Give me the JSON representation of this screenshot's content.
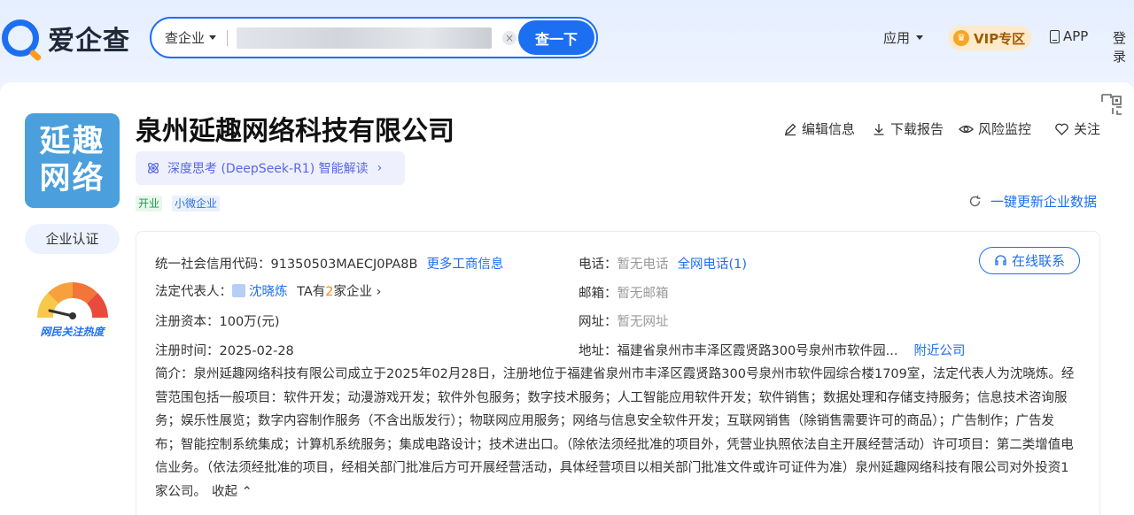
{
  "header": {
    "logo_text": "爱企查",
    "search": {
      "type_label": "查企业",
      "placeholder": "",
      "button_label": "查一下",
      "clear_glyph": "×"
    },
    "nav": {
      "apps_label": "应用",
      "vip_label": "VIP专区",
      "app_label": "APP",
      "login_label": "登录"
    }
  },
  "company": {
    "logo_line1": "延趣",
    "logo_line2": "网络",
    "name": "泉州延趣网络科技有限公司",
    "ai_label": "深度思考 (DeepSeek-R1) 智能解读",
    "tags": [
      "开业",
      "小微企业"
    ],
    "certify_label": "企业认证",
    "heat_label": "网民关注热度"
  },
  "actions": {
    "edit": "编辑信息",
    "report": "下载报告",
    "monitor": "风险监控",
    "follow": "关注",
    "refresh": "一键更新企业数据"
  },
  "info": {
    "credit_code_label": "统一社会信用代码：",
    "credit_code": "91350503MAECJ0PA8B",
    "more_link": "更多工商信息",
    "legal_rep_label": "法定代表人：",
    "legal_rep": "沈晓炼",
    "ta_prefix": "TA有",
    "ta_count": "2",
    "ta_suffix": "家企业 ›",
    "capital_label": "注册资本：",
    "capital": "100万(元)",
    "date_label": "注册时间：",
    "date": "2025-02-28",
    "phone_label": "电话：",
    "phone": "暂无电话",
    "phone_link": "全网电话(1)",
    "email_label": "邮箱：",
    "email": "暂无邮箱",
    "website_label": "网址：",
    "website": "暂无网址",
    "address_label": "地址：",
    "address": "福建省泉州市丰泽区霞贤路300号泉州市软件园...",
    "nearby_link": "附近公司",
    "online_contact": "在线联系",
    "description_label": "简介：",
    "description": "泉州延趣网络科技有限公司成立于2025年02月28日，注册地位于福建省泉州市丰泽区霞贤路300号泉州市软件园综合楼1709室，法定代表人为沈晓炼。经营范围包括一般项目：软件开发；动漫游戏开发；软件外包服务；数字技术服务；人工智能应用软件开发；软件销售；数据处理和存储支持服务；信息技术咨询服务；娱乐性展览；数字内容制作服务（不含出版发行）；物联网应用服务；网络与信息安全软件开发；互联网销售（除销售需要许可的商品）；广告制作；广告发布；智能控制系统集成；计算机系统服务；集成电路设计；技术进出口。（除依法须经批准的项目外，凭营业执照依法自主开展经营活动）许可项目：第二类增值电信业务。（依法须经批准的项目，经相关部门批准后方可开展经营活动，具体经营项目以相关部门批准文件或许可证件为准）泉州延趣网络科技有限公司对外投资1家公司。",
    "collapse_label": "收起 ⌃"
  },
  "colors": {
    "brand_blue": "#1d6ff2",
    "logo_bg": "#4a9fdc",
    "tag_green": "#1a9a4a",
    "vip_bg": "#fdeacb"
  }
}
